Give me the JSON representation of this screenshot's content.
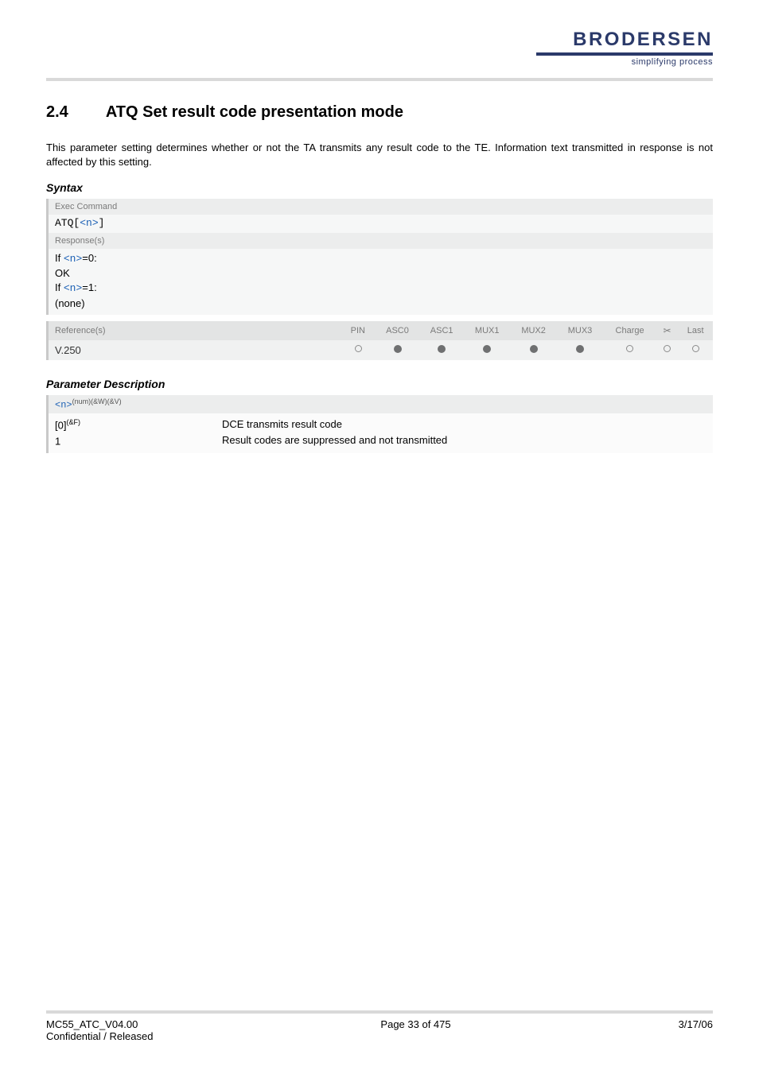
{
  "brand": {
    "name": "BRODERSEN",
    "tagline": "simplifying process"
  },
  "section": {
    "number": "2.4",
    "title": "ATQ   Set result code presentation mode"
  },
  "intro": "This parameter setting determines whether or not the TA transmits any result code to the TE. Information text transmitted in response is not affected by this setting.",
  "syntax": {
    "heading": "Syntax",
    "exec_label": "Exec Command",
    "exec_cmd_prefix": "ATQ[",
    "exec_cmd_param": "<n>",
    "exec_cmd_suffix": "]",
    "responses_label": "Response(s)",
    "resp_line1_a": "If ",
    "resp_line1_b": "<n>",
    "resp_line1_c": "=0:",
    "resp_line2": "OK",
    "resp_line3_a": "If ",
    "resp_line3_b": "<n>",
    "resp_line3_c": "=1:",
    "resp_line4": "(none)"
  },
  "ref_table": {
    "headers": [
      "Reference(s)",
      "PIN",
      "ASC0",
      "ASC1",
      "MUX1",
      "MUX2",
      "MUX3",
      "Charge",
      "",
      "Last"
    ],
    "row": {
      "label": "V.250",
      "cells": [
        "open",
        "fill",
        "fill",
        "fill",
        "fill",
        "fill",
        "open",
        "open",
        "open"
      ]
    }
  },
  "param_desc": {
    "heading": "Parameter Description",
    "tag_param": "<n>",
    "tag_sup": "(num)(&W)(&V)",
    "rows": [
      {
        "key": "[0]",
        "key_sup": "(&F)",
        "desc": "DCE transmits result code"
      },
      {
        "key": "1",
        "key_sup": "",
        "desc": "Result codes are suppressed and not transmitted"
      }
    ]
  },
  "footer": {
    "doc_id": "MC55_ATC_V04.00",
    "status": "Confidential / Released",
    "page": "Page 33 of 475",
    "date": "3/17/06"
  },
  "chart_data": {
    "type": "table",
    "title": "Reference capability matrix for V.250 (ATQ)",
    "columns": [
      "PIN",
      "ASC0",
      "ASC1",
      "MUX1",
      "MUX2",
      "MUX3",
      "Charge",
      "Tools",
      "Last"
    ],
    "rows": [
      {
        "reference": "V.250",
        "values": [
          false,
          true,
          true,
          true,
          true,
          true,
          false,
          false,
          false
        ]
      }
    ],
    "legend": {
      "true": "filled circle (supported)",
      "false": "open circle (not supported)"
    }
  }
}
